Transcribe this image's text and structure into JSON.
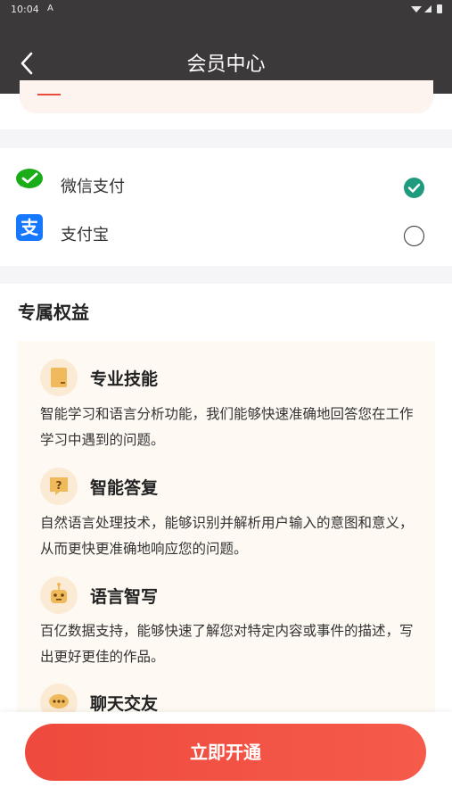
{
  "status": {
    "time": "10:04",
    "a_icon": "A",
    "icons": "▾◢▮"
  },
  "header": {
    "title": "会员中心"
  },
  "payment": {
    "options": [
      {
        "label": "微信支付",
        "selected": true,
        "icon": "wechat-pay-icon",
        "color": "#1aad19"
      },
      {
        "label": "支付宝",
        "selected": false,
        "icon": "alipay-icon",
        "color": "#1677ff"
      }
    ],
    "checked_color": "#1e9b7f"
  },
  "benefits": {
    "title": "专属权益",
    "items": [
      {
        "title": "专业技能",
        "desc": "智能学习和语言分析功能，我们能够快速准确地回答您在工作学习中遇到的问题。",
        "icon": "book-icon"
      },
      {
        "title": "智能答复",
        "desc": "自然语言处理技术，能够识别并解析用户输入的意图和意义，从而更快更准确地响应您的问题。",
        "icon": "question-bubble-icon"
      },
      {
        "title": "语言智写",
        "desc": "百亿数据支持，能够快速了解您对特定内容或事件的描述，写出更好更佳的作品。",
        "icon": "robot-icon"
      },
      {
        "title": "聊天交友",
        "desc": "",
        "icon": "chat-bubble-icon"
      }
    ]
  },
  "footer": {
    "cta_label": "立即开通",
    "accent": "#ee4a3d"
  }
}
